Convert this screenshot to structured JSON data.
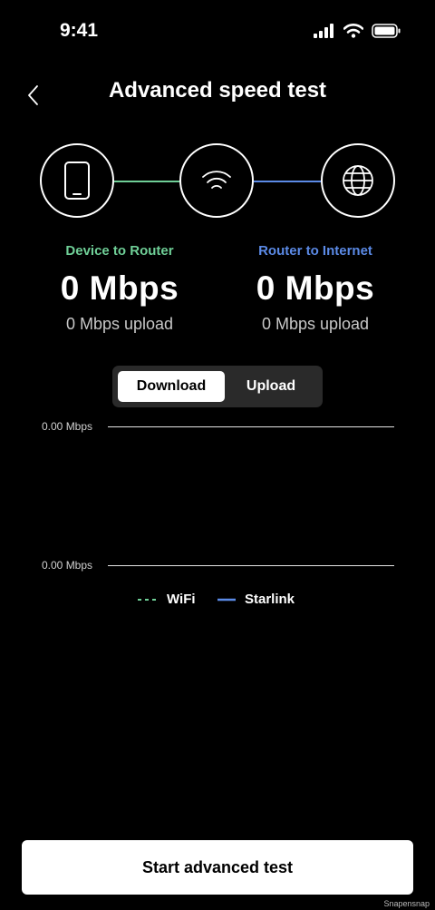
{
  "status_bar": {
    "time": "9:41"
  },
  "nav": {
    "title": "Advanced speed test"
  },
  "diagram": {
    "nodes": [
      "phone-icon",
      "wifi-icon",
      "globe-icon"
    ],
    "wifi_color": "#6fcf97",
    "starlink_color": "#5b8ae6"
  },
  "stats": {
    "device_router": {
      "label": "Device to Router",
      "value": "0 Mbps",
      "upload": "0 Mbps upload",
      "color": "#6fcf97"
    },
    "router_internet": {
      "label": "Router to Internet",
      "value": "0 Mbps",
      "upload": "0 Mbps upload",
      "color": "#5b8ae6"
    }
  },
  "toggle": {
    "download": "Download",
    "upload": "Upload",
    "selected": "Download"
  },
  "chart_data": {
    "type": "line",
    "tick_labels": [
      "0.00 Mbps",
      "0.00 Mbps"
    ],
    "series": [
      {
        "name": "WiFi",
        "style": "dashed",
        "color": "#6fcf97",
        "values": []
      },
      {
        "name": "Starlink",
        "style": "solid",
        "color": "#5b8ae6",
        "values": []
      }
    ],
    "grid": true,
    "legend": "bottom"
  },
  "start_button": {
    "label": "Start advanced test"
  },
  "watermark": "Snapensnap"
}
